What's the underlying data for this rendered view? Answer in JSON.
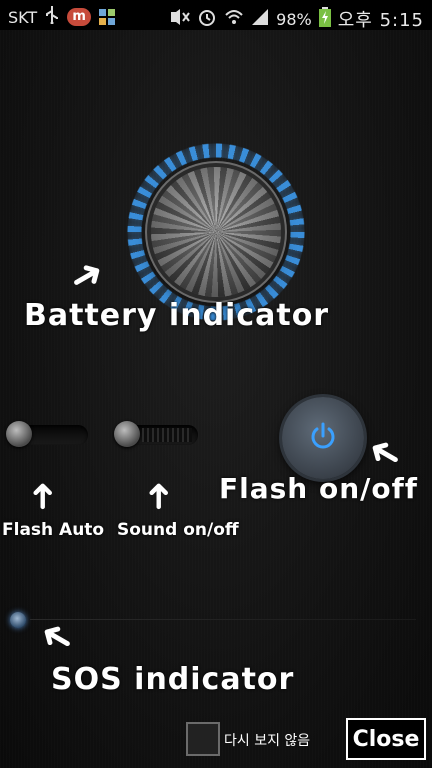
{
  "status_bar": {
    "carrier": "SKT",
    "usb_icon": "usb-icon",
    "app_icon_letter": "m",
    "battery_percent": "98%",
    "time": "오후 5:15"
  },
  "labels": {
    "battery_indicator": "Battery indicator",
    "flash_onoff": "Flash on/off",
    "flash_auto": "Flash Auto",
    "sound_onoff": "Sound on/off",
    "sos_indicator": "SOS indicator"
  },
  "footer": {
    "dont_show_again": "다시 보지 않음",
    "close_label": "Close"
  },
  "colors": {
    "accent_blue": "#3c96e6",
    "background": "#0d0d0d"
  },
  "icons": [
    "usb-icon",
    "mute-icon",
    "alarm-icon",
    "wifi-icon",
    "signal-icon",
    "battery-icon",
    "power-icon",
    "arrow-icon"
  ]
}
